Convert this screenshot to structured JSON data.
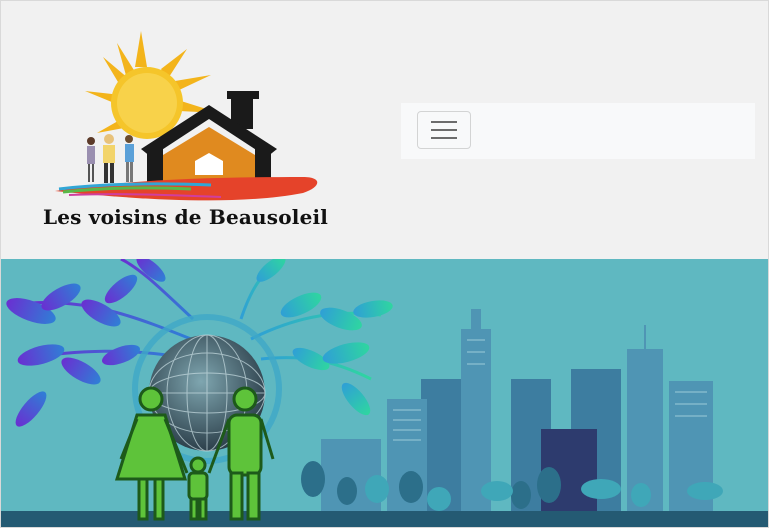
{
  "site": {
    "title": "Les voisins de Beausoleil"
  },
  "navbar": {
    "toggler_icon": "hamburger-menu-icon",
    "toggler_aria": "Toggle navigation"
  },
  "colors": {
    "header_bg": "#f1f1f1",
    "navbar_bg": "#f8f9fa",
    "banner_sky": "#5fb8c1",
    "family_green": "#5ec33a",
    "house_orange": "#e08a1f",
    "sun_yellow": "#f5c52a"
  },
  "banner": {
    "image_name": "family-globe-city-illustration"
  }
}
